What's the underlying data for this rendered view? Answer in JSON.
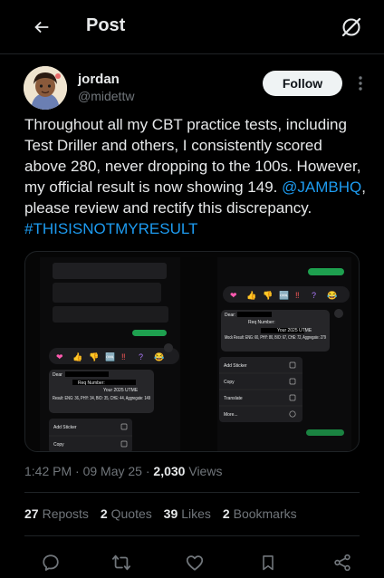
{
  "header": {
    "title": "Post",
    "back_icon": "arrow-left-icon",
    "grok_icon": "grok-icon"
  },
  "post": {
    "author": {
      "name": "jordan",
      "handle": "@midettw",
      "avatar_icon": "avatar-illustration",
      "follow_label": "Follow"
    },
    "text_parts": {
      "body": "Throughout all my CBT practice tests, including Test Driller and others, I consistently scored above 280, never dropping to the 100s. However, my official result is now showing 149. ",
      "mention": "@JAMBHQ",
      "middle": ", please review and rectify this discrepancy. ",
      "hashtag": "#THISISNOTMYRESULT"
    },
    "media": {
      "left_screenshot": {
        "reactions": [
          "❤",
          "👍",
          "👎",
          "🆒",
          "‼",
          "?",
          "😂"
        ],
        "message_lines": [
          "Dear",
          "Req Number:",
          "Your 2025 UTME",
          "Result: ENG: 36, PHY: 34, BIO: 35, CHE: 44, Aggregate: 149"
        ],
        "menu": [
          "Add Sticker",
          "Copy"
        ]
      },
      "right_screenshot": {
        "reactions": [
          "❤",
          "👍",
          "👎",
          "🆒",
          "‼",
          "?",
          "😂"
        ],
        "message_lines": [
          "Dear:",
          "Req Number:",
          "Your 2025 UTME",
          "Mock Result: ENG: 60, PHY: 80, BIO: 67, CHE: 72, Aggregate: 279"
        ],
        "menu": [
          "Add Sticker",
          "Copy",
          "Translate",
          "More..."
        ]
      }
    },
    "time": "1:42 PM",
    "date": "09 May 25",
    "views_count": "2,030",
    "views_label": "Views",
    "stats": {
      "reposts_count": "27",
      "reposts_label": "Reposts",
      "quotes_count": "2",
      "quotes_label": "Quotes",
      "likes_count": "39",
      "likes_label": "Likes",
      "bookmarks_count": "2",
      "bookmarks_label": "Bookmarks"
    },
    "actions": [
      "reply-icon",
      "repost-icon",
      "like-icon",
      "bookmark-icon",
      "share-icon"
    ]
  },
  "colors": {
    "background": "#000000",
    "text": "#e7e9ea",
    "secondary_text": "#71767b",
    "link": "#1d9bf0",
    "divider": "#1f2326",
    "follow_bg": "#eff3f4",
    "bubble_green": "#25d366"
  }
}
